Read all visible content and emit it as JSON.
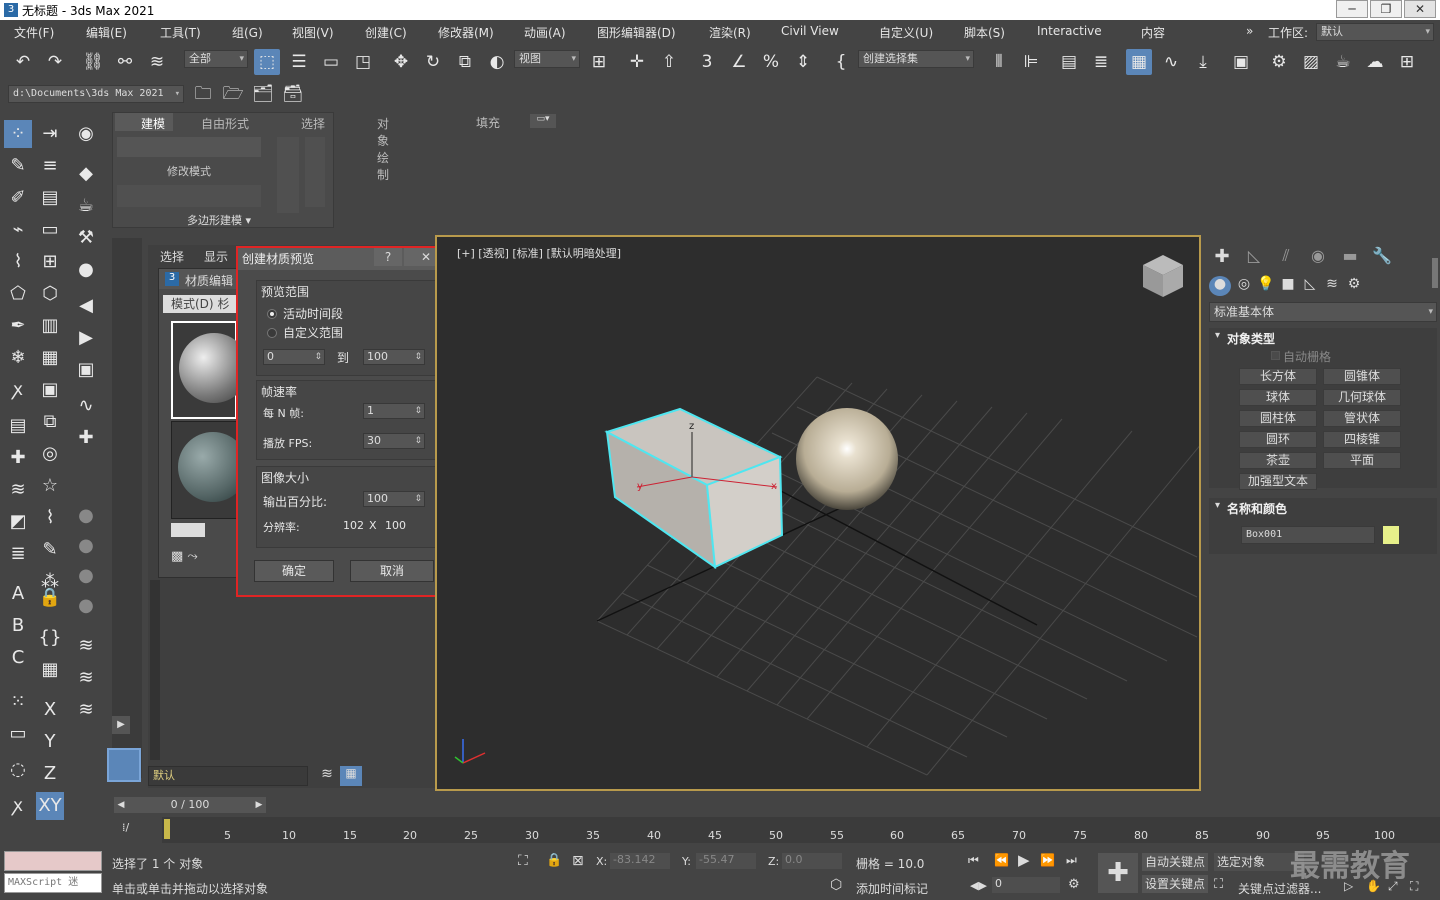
{
  "window": {
    "title": "无标题 - 3ds Max 2021",
    "minimize": "─",
    "maximize": "❐",
    "close": "✕"
  },
  "menu": [
    "文件(F)",
    "编辑(E)",
    "工具(T)",
    "组(G)",
    "视图(V)",
    "创建(C)",
    "修改器(M)",
    "动画(A)",
    "图形编辑器(D)",
    "渲染(R)",
    "Civil View",
    "自定义(U)",
    "脚本(S)",
    "Interactive",
    "内容"
  ],
  "workspace": {
    "label": "工作区:",
    "value": "默认",
    "chevron": "»"
  },
  "toolbar": {
    "filter": "全部",
    "refcoord": "视图",
    "selset": "创建选择集"
  },
  "path": "d:\\Documents\\3ds Max 2021",
  "ribbon": {
    "tabs": [
      "建模",
      "自由形式",
      "选择",
      "对象绘制",
      "填充"
    ],
    "mode_label": "修改模式",
    "poly_label": "多边形建模 ▾"
  },
  "scene_tabs": [
    "选择",
    "显示"
  ],
  "mat_editor": {
    "title": "材质编辑",
    "mode": "模式(D)",
    "mode2": "杉"
  },
  "viewport": {
    "label": "[+] [透视] [标准] [默认明暗处理]",
    "axis_z": "z",
    "axis_x": "x",
    "axis_y": "y"
  },
  "dialog": {
    "title": "创建材质预览",
    "help": "?",
    "close": "✕",
    "range": {
      "title": "预览范围",
      "active": "活动时间段",
      "custom": "自定义范围",
      "from": "0",
      "to_label": "到",
      "to": "100"
    },
    "rate": {
      "title": "帧速率",
      "every_n_label": "每 N 帧:",
      "every_n": "1",
      "fps_label": "播放 FPS:",
      "fps": "30"
    },
    "size": {
      "title": "图像大小",
      "percent_label": "输出百分比:",
      "percent": "100",
      "res_label": "分辨率:",
      "res_w": "102",
      "res_x": "X",
      "res_h": "100"
    },
    "ok": "确定",
    "cancel": "取消"
  },
  "cmd": {
    "category": "标准基本体",
    "object_type": "对象类型",
    "autogrid": "自动栅格",
    "buttons": [
      "长方体",
      "圆锥体",
      "球体",
      "几何球体",
      "圆柱体",
      "管状体",
      "圆环",
      "四棱锥",
      "茶壶",
      "平面",
      "加强型文本"
    ],
    "name_color": "名称和颜色",
    "name": "Box001",
    "swatch": "#e7f08a"
  },
  "scene_layer": "默认",
  "timeline": {
    "frame": "0 / 100",
    "ticks": [
      "5",
      "10",
      "15",
      "20",
      "25",
      "30",
      "35",
      "40",
      "45",
      "50",
      "55",
      "60",
      "65",
      "70",
      "75",
      "80",
      "85",
      "90",
      "95",
      "100"
    ]
  },
  "status": {
    "maxscript": "MAXScript 迷",
    "selected": "选择了 1 个 对象",
    "hint": "单击或单击并拖动以选择对象",
    "x_label": "X:",
    "x": "-83.142",
    "y_label": "Y:",
    "y": "-55.47",
    "z_label": "Z:",
    "z": "0.0",
    "grid": "栅格 = 10.0",
    "add_tag": "添加时间标记",
    "autokey": "自动关键点",
    "setkey": "设置关键点",
    "selected_obj": "选定对象",
    "keyfilter": "关键点过滤器...",
    "frame": "0",
    "watermark": "最需教育"
  }
}
